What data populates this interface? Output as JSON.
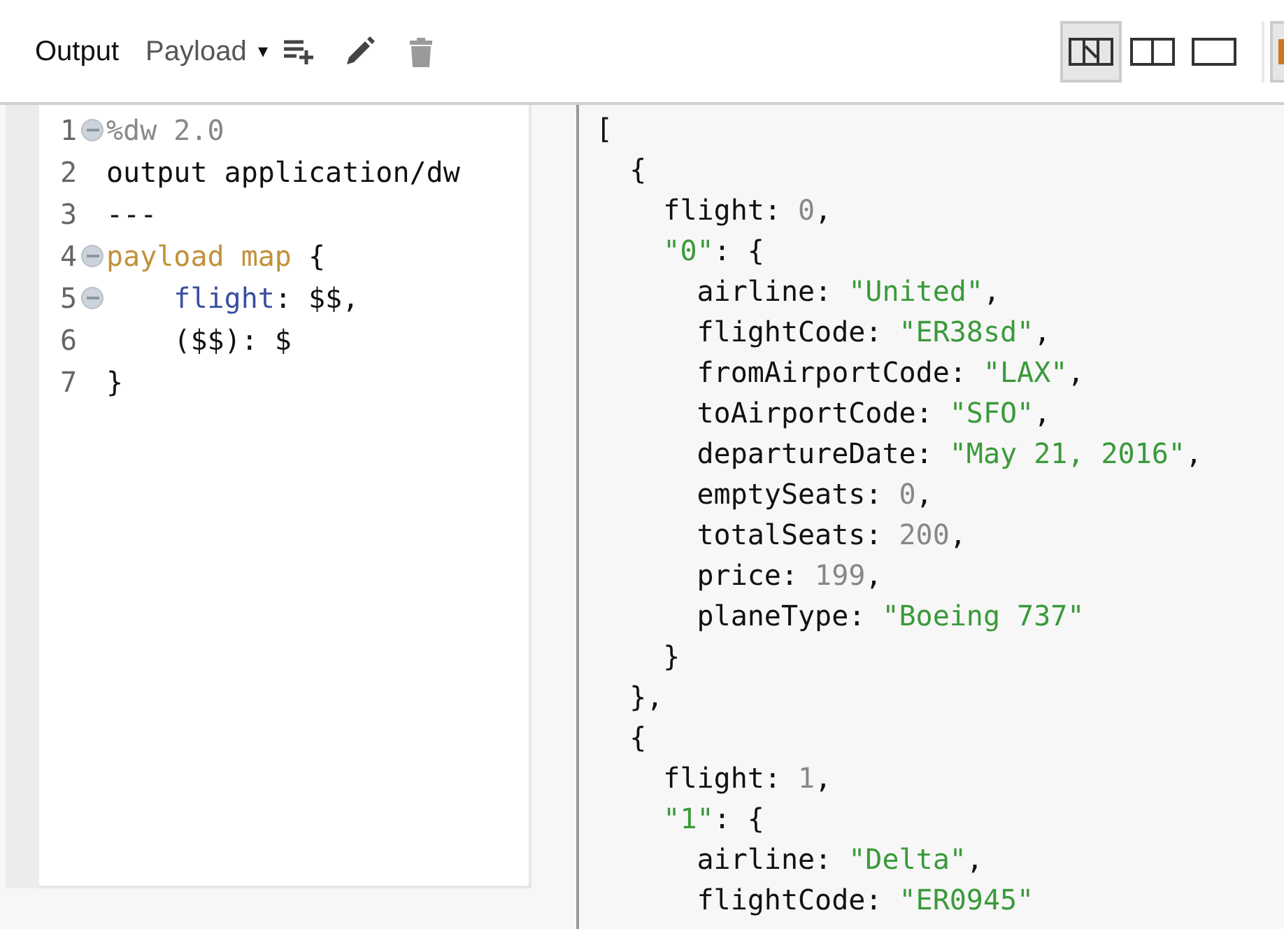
{
  "toolbar": {
    "title": "Output",
    "dropdown": {
      "label": "Payload",
      "caret": "▾"
    },
    "tools": [
      {
        "kind": "add-list",
        "disabled": false
      },
      {
        "kind": "edit",
        "disabled": false
      },
      {
        "kind": "delete",
        "disabled": true
      }
    ],
    "layout_buttons": [
      {
        "kind": "diagonal",
        "selected": true
      },
      {
        "kind": "split",
        "selected": false
      },
      {
        "kind": "single",
        "selected": false
      }
    ]
  },
  "script_editor": {
    "lines": [
      {
        "number": "1",
        "foldable": true,
        "tokens": [
          {
            "kind": "directive",
            "text": "%dw 2.0"
          }
        ]
      },
      {
        "number": "2",
        "foldable": false,
        "tokens": [
          {
            "kind": "plain",
            "text": "output application/dw"
          }
        ]
      },
      {
        "number": "3",
        "foldable": false,
        "tokens": [
          {
            "kind": "plain",
            "text": "---"
          }
        ]
      },
      {
        "number": "4",
        "foldable": true,
        "tokens": [
          {
            "kind": "keyword",
            "text": "payload map"
          },
          {
            "kind": "plain",
            "text": " {"
          }
        ]
      },
      {
        "number": "5",
        "foldable": true,
        "tokens": [
          {
            "kind": "key",
            "text": "    flight"
          },
          {
            "kind": "plain",
            "text": ": $$,"
          }
        ]
      },
      {
        "number": "6",
        "foldable": false,
        "tokens": [
          {
            "kind": "plain",
            "text": "    ($$): $"
          }
        ]
      },
      {
        "number": "7",
        "foldable": false,
        "tokens": [
          {
            "kind": "plain",
            "text": "}"
          }
        ]
      }
    ]
  },
  "output_preview": {
    "lines": [
      [
        {
          "kind": "plain",
          "text": "["
        }
      ],
      [
        {
          "kind": "plain",
          "text": "  {"
        }
      ],
      [
        {
          "kind": "plain",
          "text": "    flight: "
        },
        {
          "kind": "number",
          "text": "0"
        },
        {
          "kind": "plain",
          "text": ","
        }
      ],
      [
        {
          "kind": "string",
          "text": "    \"0\""
        },
        {
          "kind": "plain",
          "text": ": {"
        }
      ],
      [
        {
          "kind": "plain",
          "text": "      airline: "
        },
        {
          "kind": "string",
          "text": "\"United\""
        },
        {
          "kind": "plain",
          "text": ","
        }
      ],
      [
        {
          "kind": "plain",
          "text": "      flightCode: "
        },
        {
          "kind": "string",
          "text": "\"ER38sd\""
        },
        {
          "kind": "plain",
          "text": ","
        }
      ],
      [
        {
          "kind": "plain",
          "text": "      fromAirportCode: "
        },
        {
          "kind": "string",
          "text": "\"LAX\""
        },
        {
          "kind": "plain",
          "text": ","
        }
      ],
      [
        {
          "kind": "plain",
          "text": "      toAirportCode: "
        },
        {
          "kind": "string",
          "text": "\"SFO\""
        },
        {
          "kind": "plain",
          "text": ","
        }
      ],
      [
        {
          "kind": "plain",
          "text": "      departureDate: "
        },
        {
          "kind": "string",
          "text": "\"May 21, 2016\""
        },
        {
          "kind": "plain",
          "text": ","
        }
      ],
      [
        {
          "kind": "plain",
          "text": "      emptySeats: "
        },
        {
          "kind": "number",
          "text": "0"
        },
        {
          "kind": "plain",
          "text": ","
        }
      ],
      [
        {
          "kind": "plain",
          "text": "      totalSeats: "
        },
        {
          "kind": "number",
          "text": "200"
        },
        {
          "kind": "plain",
          "text": ","
        }
      ],
      [
        {
          "kind": "plain",
          "text": "      price: "
        },
        {
          "kind": "number",
          "text": "199"
        },
        {
          "kind": "plain",
          "text": ","
        }
      ],
      [
        {
          "kind": "plain",
          "text": "      planeType: "
        },
        {
          "kind": "string",
          "text": "\"Boeing 737\""
        }
      ],
      [
        {
          "kind": "plain",
          "text": "    }"
        }
      ],
      [
        {
          "kind": "plain",
          "text": "  },"
        }
      ],
      [
        {
          "kind": "plain",
          "text": "  {"
        }
      ],
      [
        {
          "kind": "plain",
          "text": "    flight: "
        },
        {
          "kind": "number",
          "text": "1"
        },
        {
          "kind": "plain",
          "text": ","
        }
      ],
      [
        {
          "kind": "string",
          "text": "    \"1\""
        },
        {
          "kind": "plain",
          "text": ": {"
        }
      ],
      [
        {
          "kind": "plain",
          "text": "      airline: "
        },
        {
          "kind": "string",
          "text": "\"Delta\""
        },
        {
          "kind": "plain",
          "text": ","
        }
      ],
      [
        {
          "kind": "plain",
          "text": "      flightCode: "
        },
        {
          "kind": "string",
          "text": "\"ER0945\""
        }
      ]
    ]
  }
}
